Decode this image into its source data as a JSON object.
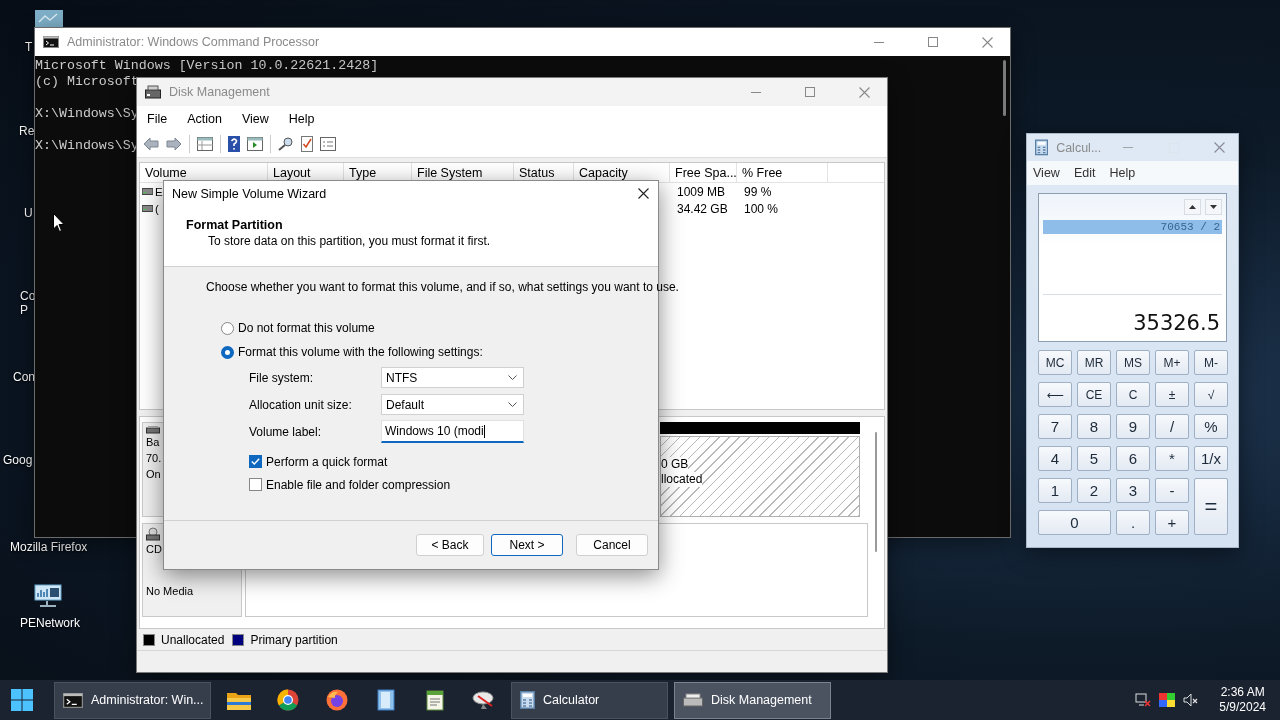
{
  "desktop": {
    "icons": [
      {
        "lines": [
          "T"
        ],
        "kind": "fragment"
      },
      {
        "lines": [
          "Re"
        ],
        "kind": "fragment"
      },
      {
        "lines": [
          "U"
        ],
        "kind": "fragment"
      },
      {
        "lines": [
          "Co",
          "P"
        ],
        "kind": "fragment"
      },
      {
        "lines": [
          "Con"
        ],
        "kind": "fragment"
      },
      {
        "lines": [
          "Goog"
        ],
        "kind": "fragment"
      },
      {
        "lines": [
          "Mozilla Firefox"
        ],
        "kind": "label"
      },
      {
        "lines": [
          "PENetwork"
        ],
        "kind": "network"
      }
    ]
  },
  "cmd_window": {
    "title": "Administrator: Windows Command Processor",
    "active": false,
    "blocks": [
      [
        "Microsoft Windows [Version 10.0.22621.2428]",
        "(c) Microsoft"
      ],
      [
        "X:\\Windows\\Sy"
      ],
      [
        "X:\\Windows\\Sy"
      ]
    ]
  },
  "disk_management": {
    "title": "Disk Management",
    "active": false,
    "menu": [
      "File",
      "Action",
      "View",
      "Help"
    ],
    "columns": [
      "Volume",
      "Layout",
      "Type",
      "File System",
      "Status",
      "Capacity",
      "Free Spa...",
      "% Free"
    ],
    "rows": [
      {
        "volume": "E",
        "free_space": "1009 MB",
        "percent_free": "99 %"
      },
      {
        "volume": "(",
        "free_space": "34.42 GB",
        "percent_free": "100 %"
      }
    ],
    "disks": [
      {
        "kind": "disk",
        "info": [
          "Ba",
          "70.",
          "On"
        ],
        "partition": {
          "lines": [
            "0 GB",
            "llocated"
          ]
        }
      },
      {
        "kind": "cdrom",
        "info": [
          "CD"
        ],
        "status": "No Media"
      }
    ],
    "legend": [
      {
        "label": "Unallocated",
        "color": "#000000"
      },
      {
        "label": "Primary partition",
        "color": "#00007f"
      }
    ]
  },
  "wizard": {
    "title": "New Simple Volume Wizard",
    "heading": "Format Partition",
    "subheading": "To store data on this partition, you must format it first.",
    "instruction": "Choose whether you want to format this volume, and if so, what settings you want to use.",
    "options": [
      {
        "label": "Do not format this volume",
        "selected": false
      },
      {
        "label": "Format this volume with the following settings:",
        "selected": true
      }
    ],
    "fields": [
      {
        "kind": "dropdown",
        "label": "File system:",
        "value": "NTFS"
      },
      {
        "kind": "dropdown",
        "label": "Allocation unit size:",
        "value": "Default"
      },
      {
        "kind": "text",
        "label": "Volume label:",
        "value": "Windows 10 (modi",
        "focused": true
      }
    ],
    "checkboxes": [
      {
        "label": "Perform a quick format",
        "checked": true
      },
      {
        "label": "Enable file and folder compression",
        "checked": false
      }
    ],
    "buttons": [
      {
        "label": "< Back",
        "default": false
      },
      {
        "label": "Next >",
        "default": true
      },
      {
        "label": "Cancel",
        "default": false
      }
    ]
  },
  "calculator": {
    "title": "Calcul...",
    "menu": [
      "View",
      "Edit",
      "Help"
    ],
    "history": "70653 / 2",
    "result": "35326.5",
    "keys": [
      {
        "label": "MC",
        "kind": "key"
      },
      {
        "label": "MR",
        "kind": "key"
      },
      {
        "label": "MS",
        "kind": "key"
      },
      {
        "label": "M+",
        "kind": "key"
      },
      {
        "label": "M-",
        "kind": "key"
      },
      {
        "label": "⟵",
        "kind": "key"
      },
      {
        "label": "CE",
        "kind": "key"
      },
      {
        "label": "C",
        "kind": "key"
      },
      {
        "label": "±",
        "kind": "key"
      },
      {
        "label": "√",
        "kind": "key"
      },
      {
        "label": "7",
        "kind": "key"
      },
      {
        "label": "8",
        "kind": "key"
      },
      {
        "label": "9",
        "kind": "key"
      },
      {
        "label": "/",
        "kind": "key"
      },
      {
        "label": "%",
        "kind": "key"
      },
      {
        "label": "4",
        "kind": "key"
      },
      {
        "label": "5",
        "kind": "key"
      },
      {
        "label": "6",
        "kind": "key"
      },
      {
        "label": "*",
        "kind": "key"
      },
      {
        "label": "1/x",
        "kind": "key"
      },
      {
        "label": "1",
        "kind": "key"
      },
      {
        "label": "2",
        "kind": "key"
      },
      {
        "label": "3",
        "kind": "key"
      },
      {
        "label": "-",
        "kind": "key"
      },
      {
        "label": "=",
        "kind": "tall"
      },
      {
        "label": "0",
        "kind": "wide"
      },
      {
        "label": ".",
        "kind": "key"
      },
      {
        "label": "+",
        "kind": "key"
      }
    ]
  },
  "taskbar": {
    "windows": [
      {
        "label": "Administrator: Win...",
        "selected": false
      },
      {
        "label": "Calculator",
        "selected": false
      },
      {
        "label": "Disk Management",
        "selected": true
      }
    ],
    "time": "2:36 AM",
    "date": "5/9/2024"
  }
}
